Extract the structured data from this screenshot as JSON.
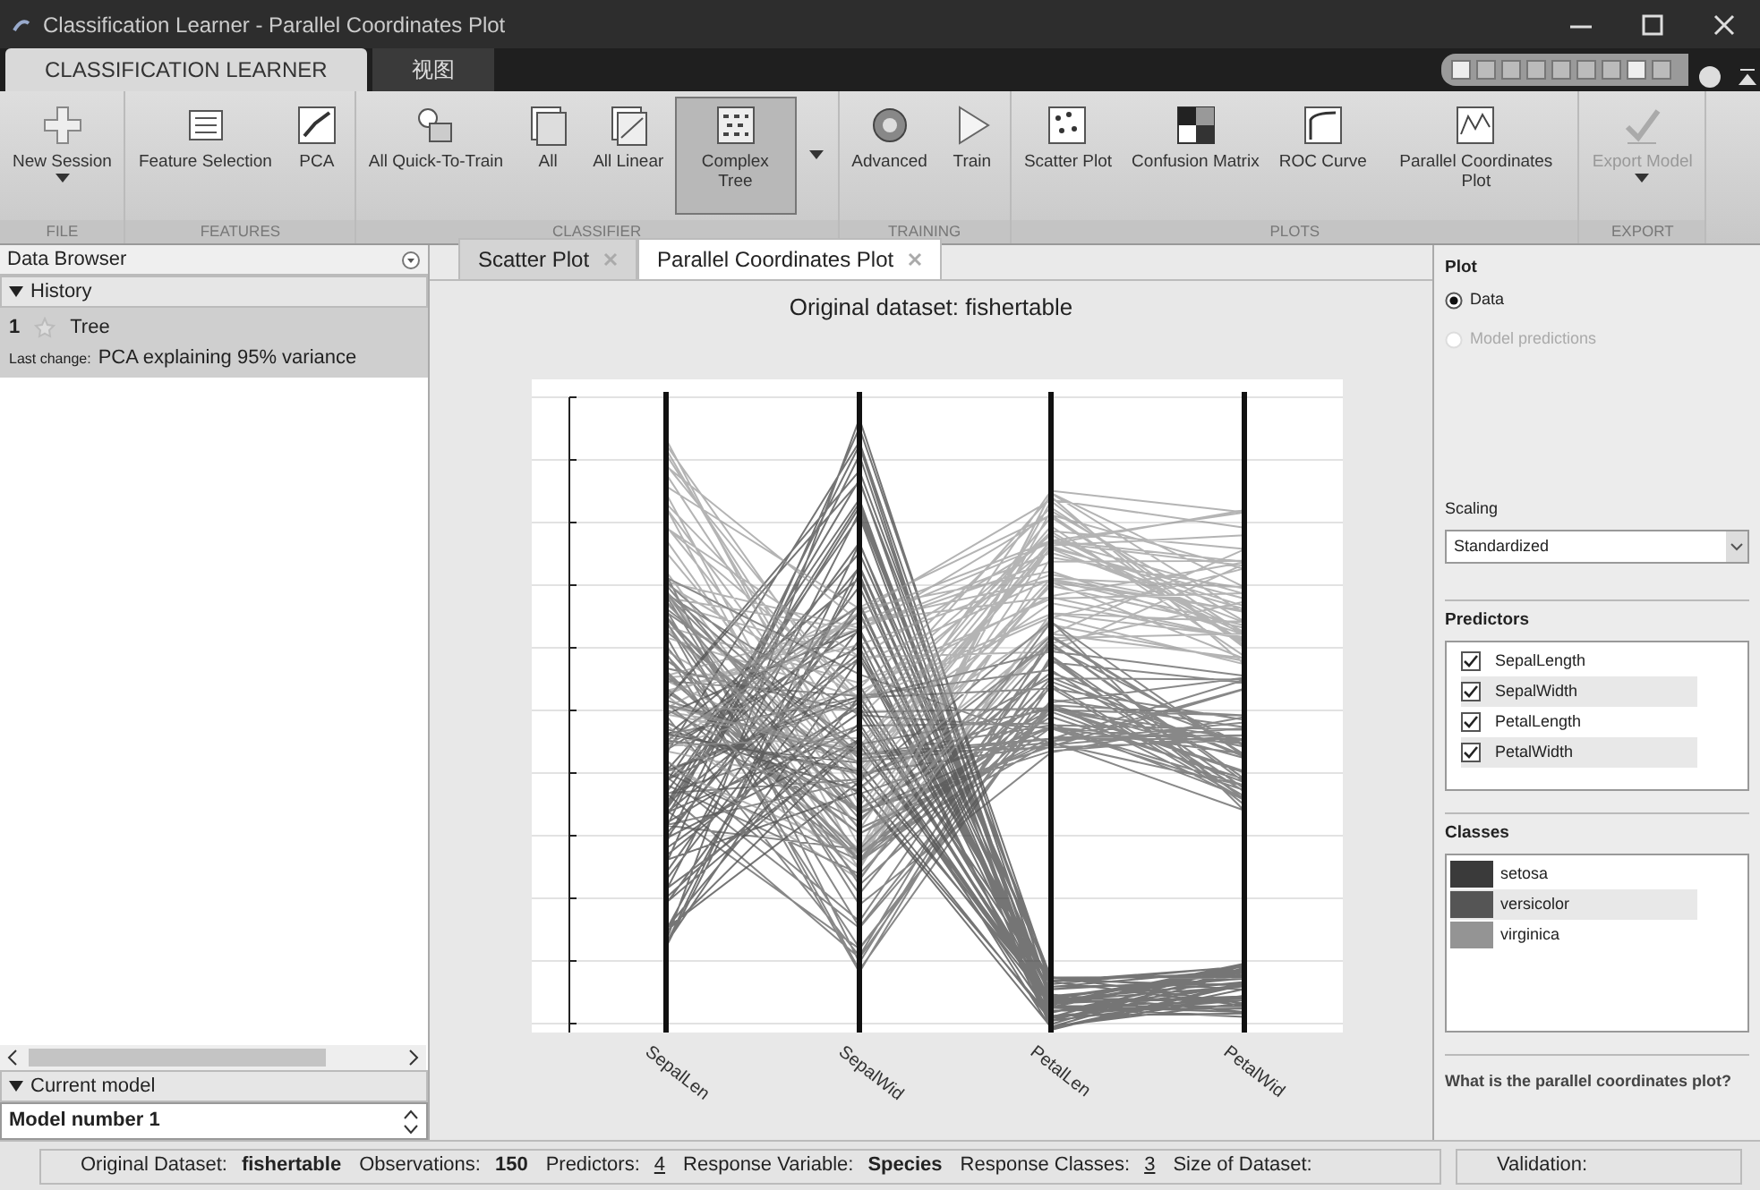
{
  "window": {
    "title": "Classification Learner - Parallel Coordinates Plot"
  },
  "toolstrip_tabs": [
    {
      "label": "CLASSIFICATION LEARNER",
      "selected": true
    },
    {
      "label": "视图",
      "selected": false
    }
  ],
  "ribbon": [
    {
      "label": "FILE",
      "buttons": [
        {
          "label": "New Session",
          "dropdown": true,
          "selected": false,
          "disabled": false
        }
      ]
    },
    {
      "label": "FEATURES",
      "buttons": [
        {
          "label": "Feature Selection",
          "dropdown": false,
          "selected": false,
          "disabled": false
        },
        {
          "label": "PCA",
          "dropdown": false,
          "selected": false,
          "disabled": false
        }
      ]
    },
    {
      "label": "CLASSIFIER",
      "buttons": [
        {
          "label": "All Quick-To-Train",
          "dropdown": false,
          "selected": false,
          "disabled": false
        },
        {
          "label": "All",
          "dropdown": false,
          "selected": false,
          "disabled": false
        },
        {
          "label": "All Linear",
          "dropdown": false,
          "selected": false,
          "disabled": false
        },
        {
          "label": "Complex Tree",
          "dropdown": false,
          "selected": true,
          "disabled": false
        }
      ]
    },
    {
      "label": "TRAINING",
      "buttons": [
        {
          "label": "Advanced",
          "dropdown": false,
          "selected": false,
          "disabled": false
        },
        {
          "label": "Train",
          "dropdown": false,
          "selected": false,
          "disabled": false
        }
      ]
    },
    {
      "label": "PLOTS",
      "buttons": [
        {
          "label": "Scatter Plot",
          "dropdown": false,
          "selected": false,
          "disabled": false
        },
        {
          "label": "Confusion Matrix",
          "dropdown": false,
          "selected": false,
          "disabled": false
        },
        {
          "label": "ROC Curve",
          "dropdown": false,
          "selected": false,
          "disabled": false
        },
        {
          "label": "Parallel Coordinates Plot",
          "dropdown": false,
          "selected": false,
          "disabled": false
        }
      ]
    },
    {
      "label": "EXPORT",
      "buttons": [
        {
          "label": "Export Model",
          "dropdown": true,
          "selected": false,
          "disabled": true
        }
      ]
    }
  ],
  "data_browser": {
    "title": "Data Browser",
    "history": {
      "label": "History",
      "expanded": true,
      "items": [
        {
          "number": "1",
          "name": "Tree",
          "last_change_label": "Last change:",
          "last_change": "PCA explaining 95% variance",
          "selected": true
        }
      ]
    },
    "current_model": {
      "label": "Current model",
      "expanded": true,
      "value": "Model number 1"
    }
  },
  "document_tabs": [
    {
      "label": "Scatter Plot",
      "selected": false
    },
    {
      "label": "Parallel Coordinates Plot",
      "selected": true
    }
  ],
  "plot": {
    "title": "Original dataset: fishertable",
    "axis_labels": [
      "SepalLen",
      "SepalWid",
      "PetalLen",
      "PetalWid"
    ]
  },
  "options": {
    "plot": {
      "title": "Plot",
      "choices": [
        {
          "label": "Data",
          "selected": true,
          "disabled": false
        },
        {
          "label": "Model predictions",
          "selected": false,
          "disabled": true
        }
      ]
    },
    "scaling": {
      "label": "Scaling",
      "value": "Standardized"
    },
    "predictors": {
      "title": "Predictors",
      "items": [
        {
          "label": "SepalLength",
          "checked": true
        },
        {
          "label": "SepalWidth",
          "checked": true
        },
        {
          "label": "PetalLength",
          "checked": true
        },
        {
          "label": "PetalWidth",
          "checked": true
        }
      ]
    },
    "classes": {
      "title": "Classes",
      "items": [
        {
          "label": "setosa",
          "color": "#3a3a3a"
        },
        {
          "label": "versicolor",
          "color": "#555555"
        },
        {
          "label": "virginica",
          "color": "#949494"
        }
      ]
    },
    "help": "What is the parallel coordinates plot?"
  },
  "status_bar": {
    "items": [
      {
        "label": "Original Dataset:",
        "value": "fishertable",
        "kind": "bold"
      },
      {
        "label": "Observations:",
        "value": "150",
        "kind": "bold"
      },
      {
        "label": "Predictors:",
        "value": "4",
        "kind": "link"
      },
      {
        "label": "Response Variable:",
        "value": "Species",
        "kind": "bold"
      },
      {
        "label": "Response Classes:",
        "value": "3",
        "kind": "link"
      },
      {
        "label": "Size of Dataset:"
      }
    ],
    "validation_label": "Validation:"
  }
}
